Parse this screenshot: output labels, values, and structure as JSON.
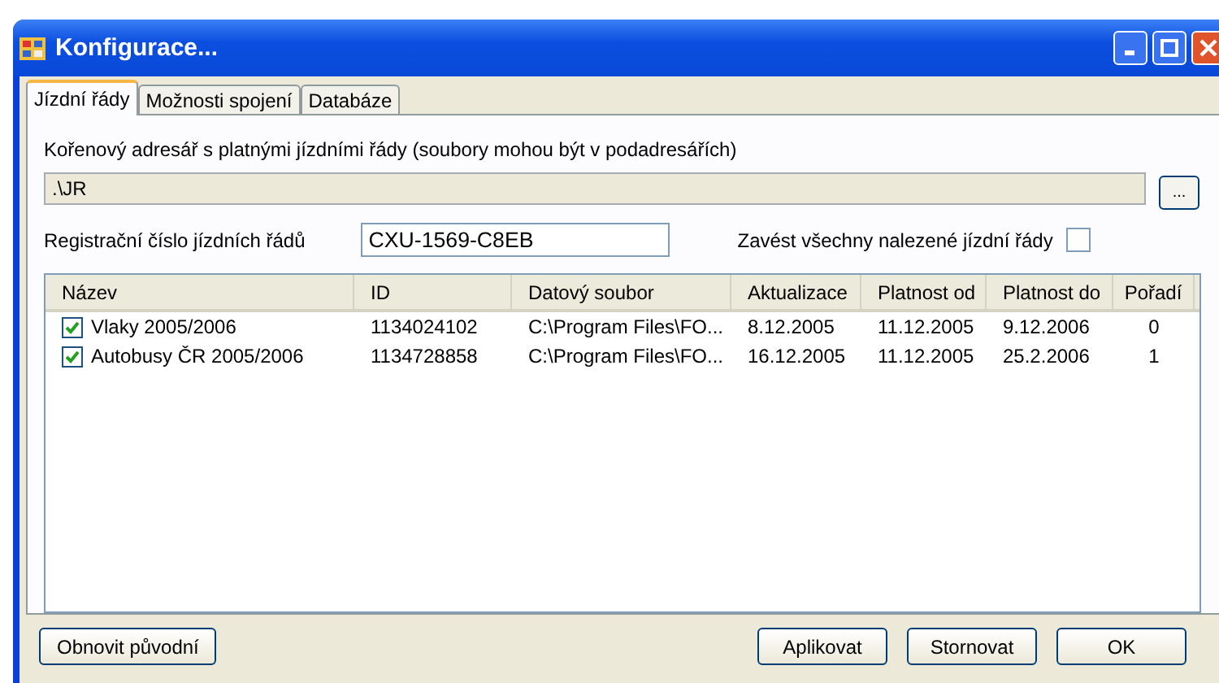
{
  "window": {
    "title": "Konfigurace..."
  },
  "tabs": [
    {
      "label": "Jízdní řády",
      "selected": true
    },
    {
      "label": "Možnosti spojení",
      "selected": false
    },
    {
      "label": "Databáze",
      "selected": false
    }
  ],
  "root_dir": {
    "label": "Kořenový adresář s platnými jízdními řády (soubory mohou být v podadresářích)",
    "value": ".\\JR",
    "browse": "..."
  },
  "registration": {
    "label": "Registrační číslo jízdních řádů",
    "value": "CXU-1569-C8EB"
  },
  "load_all": {
    "label": "Zavést všechny nalezené jízdní řády",
    "checked": false
  },
  "table": {
    "columns": [
      "Název",
      "ID",
      "Datový soubor",
      "Aktualizace",
      "Platnost od",
      "Platnost do",
      "Pořadí"
    ],
    "rows": [
      {
        "checked": true,
        "cells": [
          "Vlaky 2005/2006",
          "1134024102",
          "C:\\Program Files\\FO...",
          "8.12.2005",
          "11.12.2005",
          "9.12.2006",
          "0"
        ]
      },
      {
        "checked": true,
        "cells": [
          "Autobusy ČR 2005/2006",
          "1134728858",
          "C:\\Program Files\\FO...",
          "16.12.2005",
          "11.12.2005",
          "25.2.2006",
          "1"
        ]
      }
    ]
  },
  "buttons": {
    "left": "Obnovit původní",
    "right": [
      "Aplikovat",
      "Stornovat",
      "OK"
    ]
  }
}
